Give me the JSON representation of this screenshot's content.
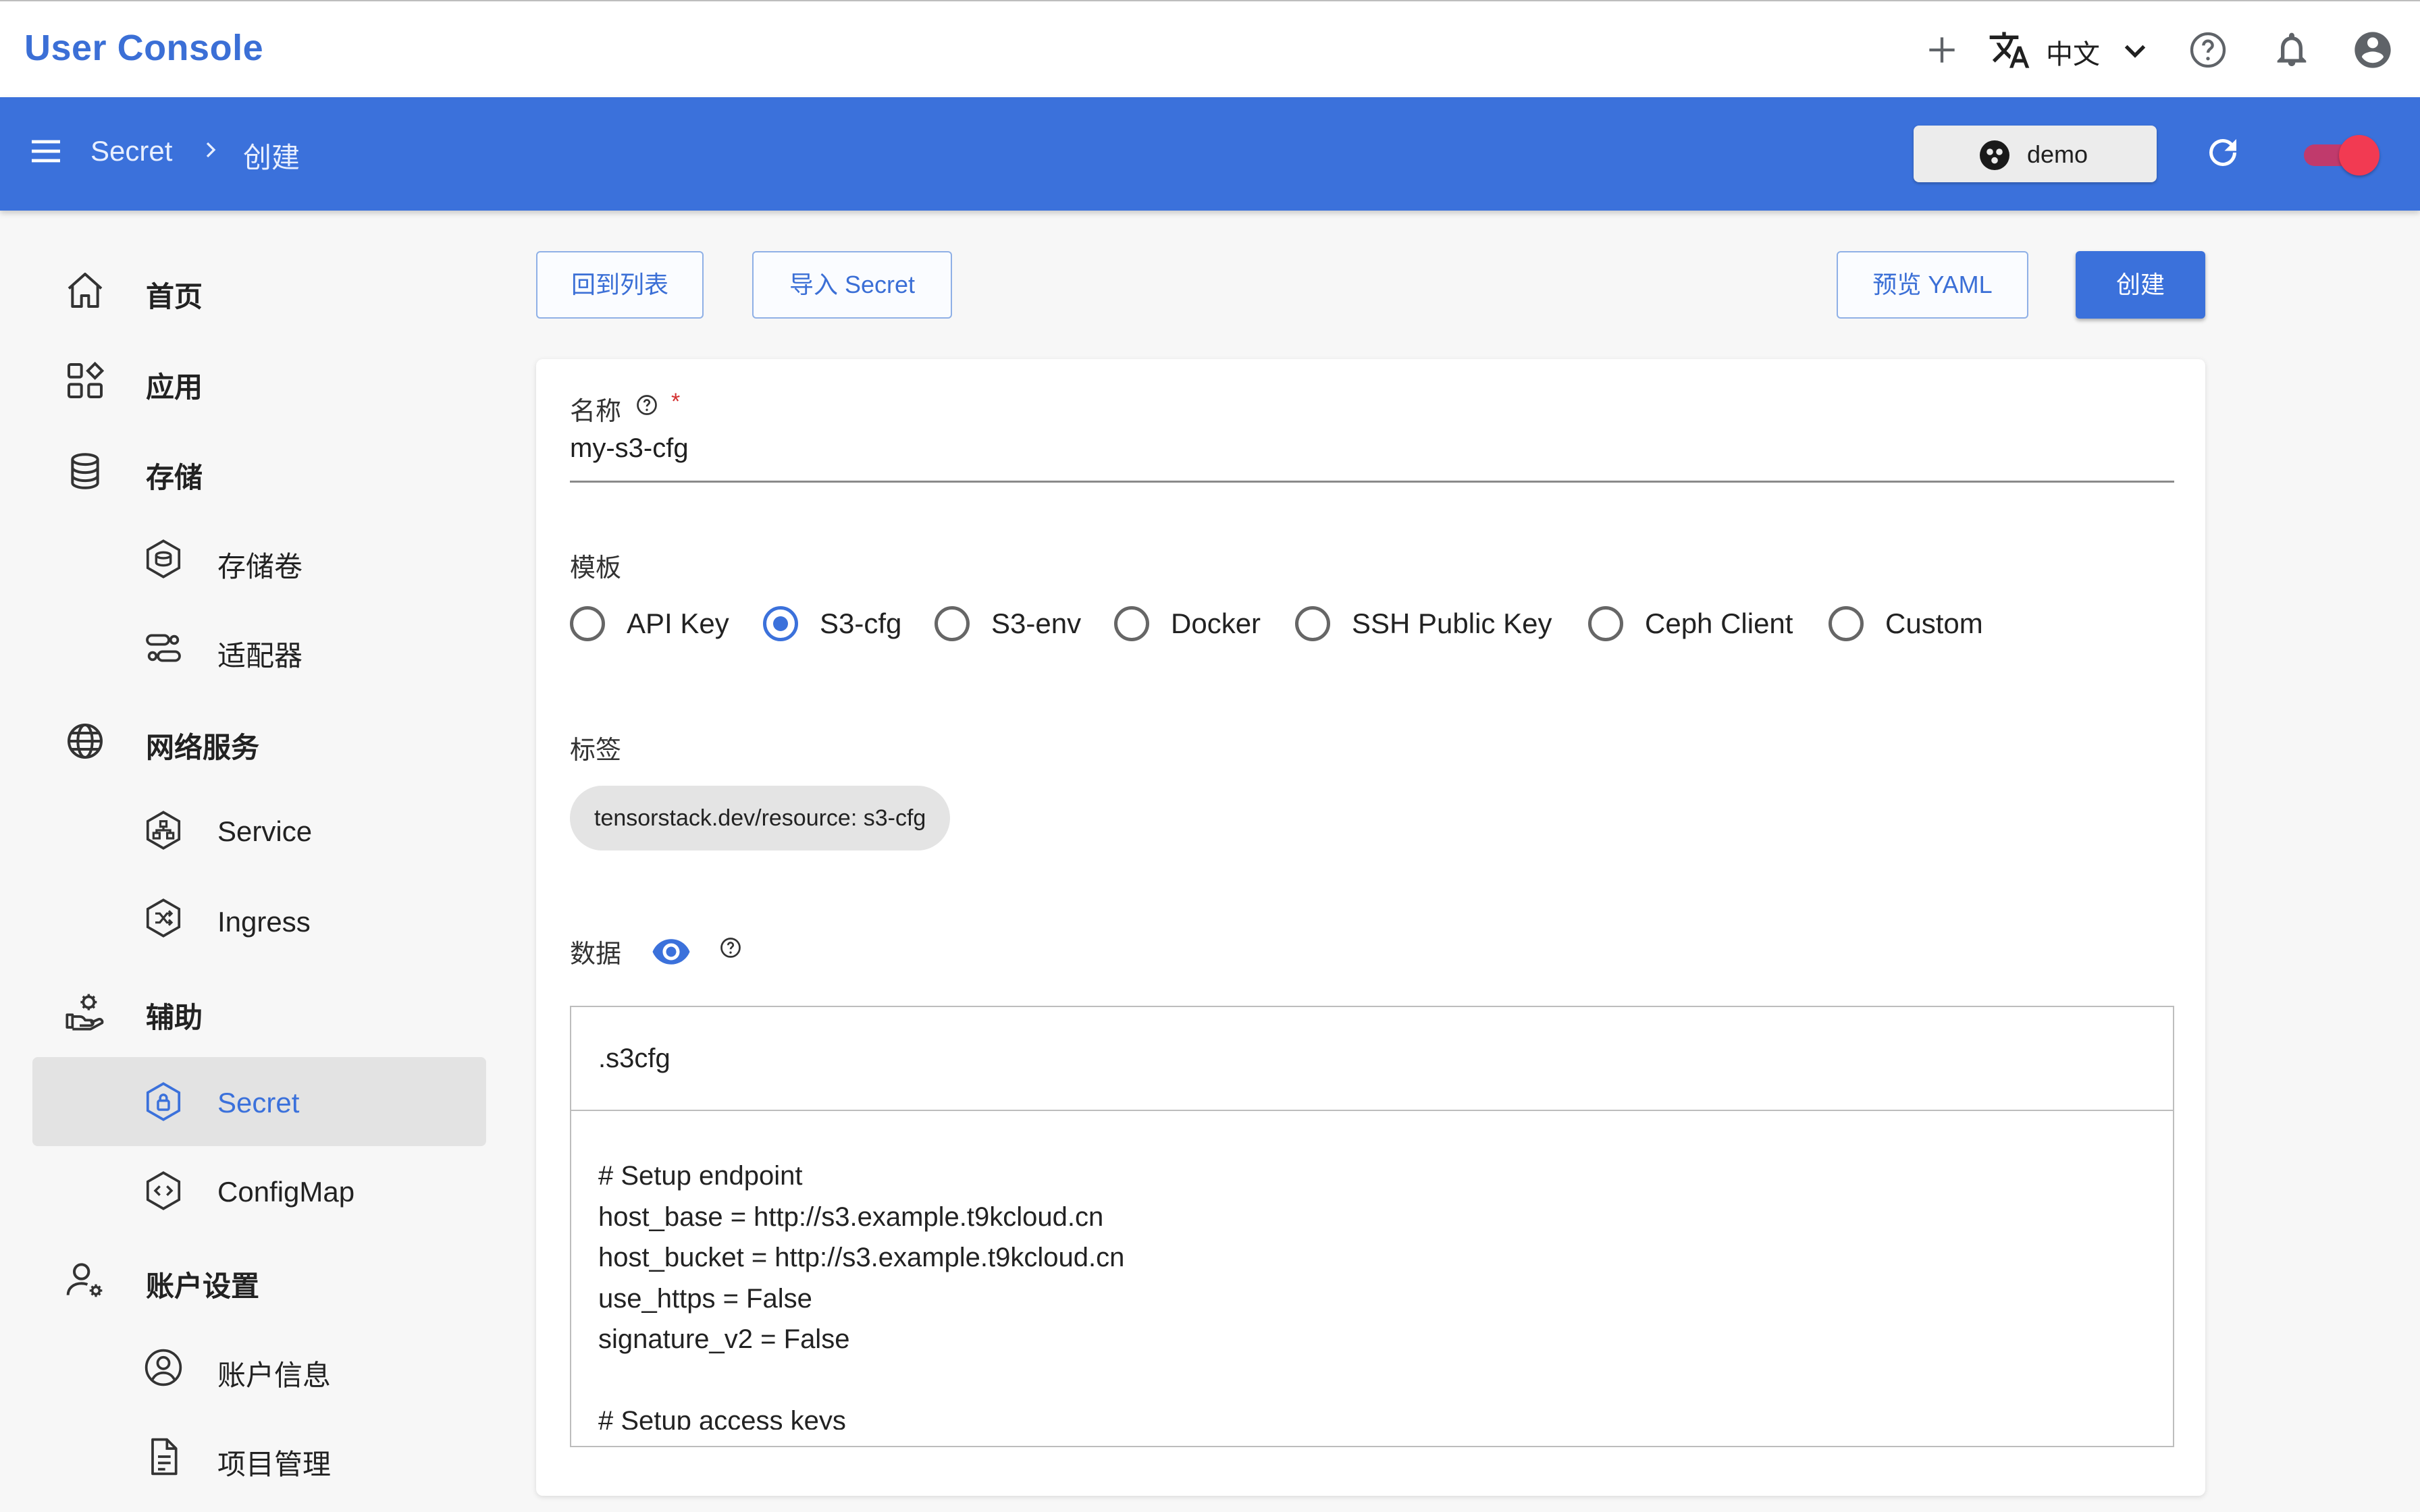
{
  "app": {
    "title": "User Console"
  },
  "topbar": {
    "language": "中文"
  },
  "header": {
    "breadcrumb": [
      "Secret",
      "创建"
    ],
    "project": "demo"
  },
  "sidebar": {
    "items": [
      {
        "label": "首页",
        "icon": "home-icon",
        "level": 1
      },
      {
        "label": "应用",
        "icon": "apps-icon",
        "level": 1
      },
      {
        "label": "存储",
        "icon": "database-icon",
        "level": 1
      },
      {
        "label": "存储卷",
        "icon": "volume-icon",
        "level": 2
      },
      {
        "label": "适配器",
        "icon": "adapter-icon",
        "level": 2
      },
      {
        "label": "网络服务",
        "icon": "globe-icon",
        "level": 1
      },
      {
        "label": "Service",
        "icon": "service-icon",
        "level": 2
      },
      {
        "label": "Ingress",
        "icon": "ingress-icon",
        "level": 2
      },
      {
        "label": "辅助",
        "icon": "assist-icon",
        "level": 1
      },
      {
        "label": "Secret",
        "icon": "secret-icon",
        "level": 2,
        "selected": true
      },
      {
        "label": "ConfigMap",
        "icon": "configmap-icon",
        "level": 2
      },
      {
        "label": "账户设置",
        "icon": "account-settings-icon",
        "level": 1
      },
      {
        "label": "账户信息",
        "icon": "account-info-icon",
        "level": 2
      },
      {
        "label": "项目管理",
        "icon": "project-manage-icon",
        "level": 2
      }
    ]
  },
  "toolbar": {
    "back": "回到列表",
    "import": "导入 Secret",
    "preview": "预览 YAML",
    "create": "创建"
  },
  "form": {
    "name_label": "名称",
    "required_mark": "*",
    "name_value": "my-s3-cfg",
    "template_label": "模板",
    "templates": [
      "API Key",
      "S3-cfg",
      "S3-env",
      "Docker",
      "SSH Public Key",
      "Ceph Client",
      "Custom"
    ],
    "selected_template": "S3-cfg",
    "labels_label": "标签",
    "label_chip": "tensorstack.dev/resource: s3-cfg",
    "data_label": "数据",
    "data_key": ".s3cfg",
    "data_value_lines": [
      "# Setup endpoint",
      "host_base = http://s3.example.t9kcloud.cn",
      "host_bucket = http://s3.example.t9kcloud.cn",
      "use_https = False",
      "signature_v2 = False",
      "",
      "# Setup access keys"
    ]
  },
  "colors": {
    "brand": "#3b71db",
    "title": "#3b6fd6",
    "toggle": "#f23a52",
    "required": "#d32f2f"
  }
}
